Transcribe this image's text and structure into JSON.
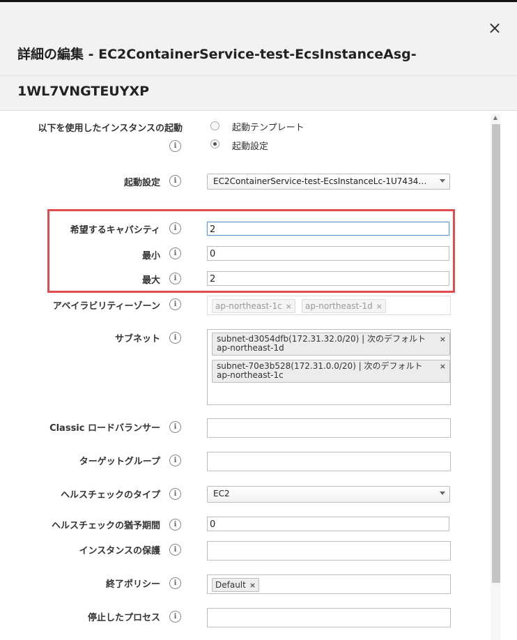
{
  "dialog": {
    "title_line1": "詳細の編集 - EC2ContainerService-test-EcsInstanceAsg-",
    "title_line2": "1WL7VNGTEUYXP",
    "close_glyph": "×"
  },
  "info_glyph": "i",
  "launch_source": {
    "label": "以下を使用したインスタンスの起動",
    "options": [
      "起動テンプレート",
      "起動設定"
    ],
    "selected": "起動設定"
  },
  "launch_config": {
    "label": "起動設定",
    "value": "EC2ContainerService-test-EcsInstanceLc-1U7434…"
  },
  "desired_capacity": {
    "label": "希望するキャパシティ",
    "value": "2"
  },
  "min_size": {
    "label": "最小",
    "value": "0"
  },
  "max_size": {
    "label": "最大",
    "value": "2"
  },
  "availability_zones": {
    "label": "アベイラビリティーゾーン",
    "tags": [
      "ap-northeast-1c",
      "ap-northeast-1d"
    ]
  },
  "subnets": {
    "label": "サブネット",
    "items": [
      {
        "line1": "subnet-d3054dfb(172.31.32.0/20) | 次のデフォルト",
        "line2": "ap-northeast-1d"
      },
      {
        "line1": "subnet-70e3b528(172.31.0.0/20) | 次のデフォルト",
        "line2": "ap-northeast-1c"
      }
    ]
  },
  "classic_lb": {
    "label": "Classic ロードバランサー",
    "value": ""
  },
  "target_group": {
    "label": "ターゲットグループ",
    "value": ""
  },
  "health_check_type": {
    "label": "ヘルスチェックのタイプ",
    "value": "EC2"
  },
  "health_check_grace": {
    "label": "ヘルスチェックの猶予期間",
    "value": "0"
  },
  "instance_protection": {
    "label": "インスタンスの保護",
    "value": ""
  },
  "termination_policy": {
    "label": "終了ポリシー",
    "tags": [
      "Default"
    ]
  },
  "suspended_processes": {
    "label": "停止したプロセス",
    "value": ""
  },
  "tag_remove_glyph": "×"
}
